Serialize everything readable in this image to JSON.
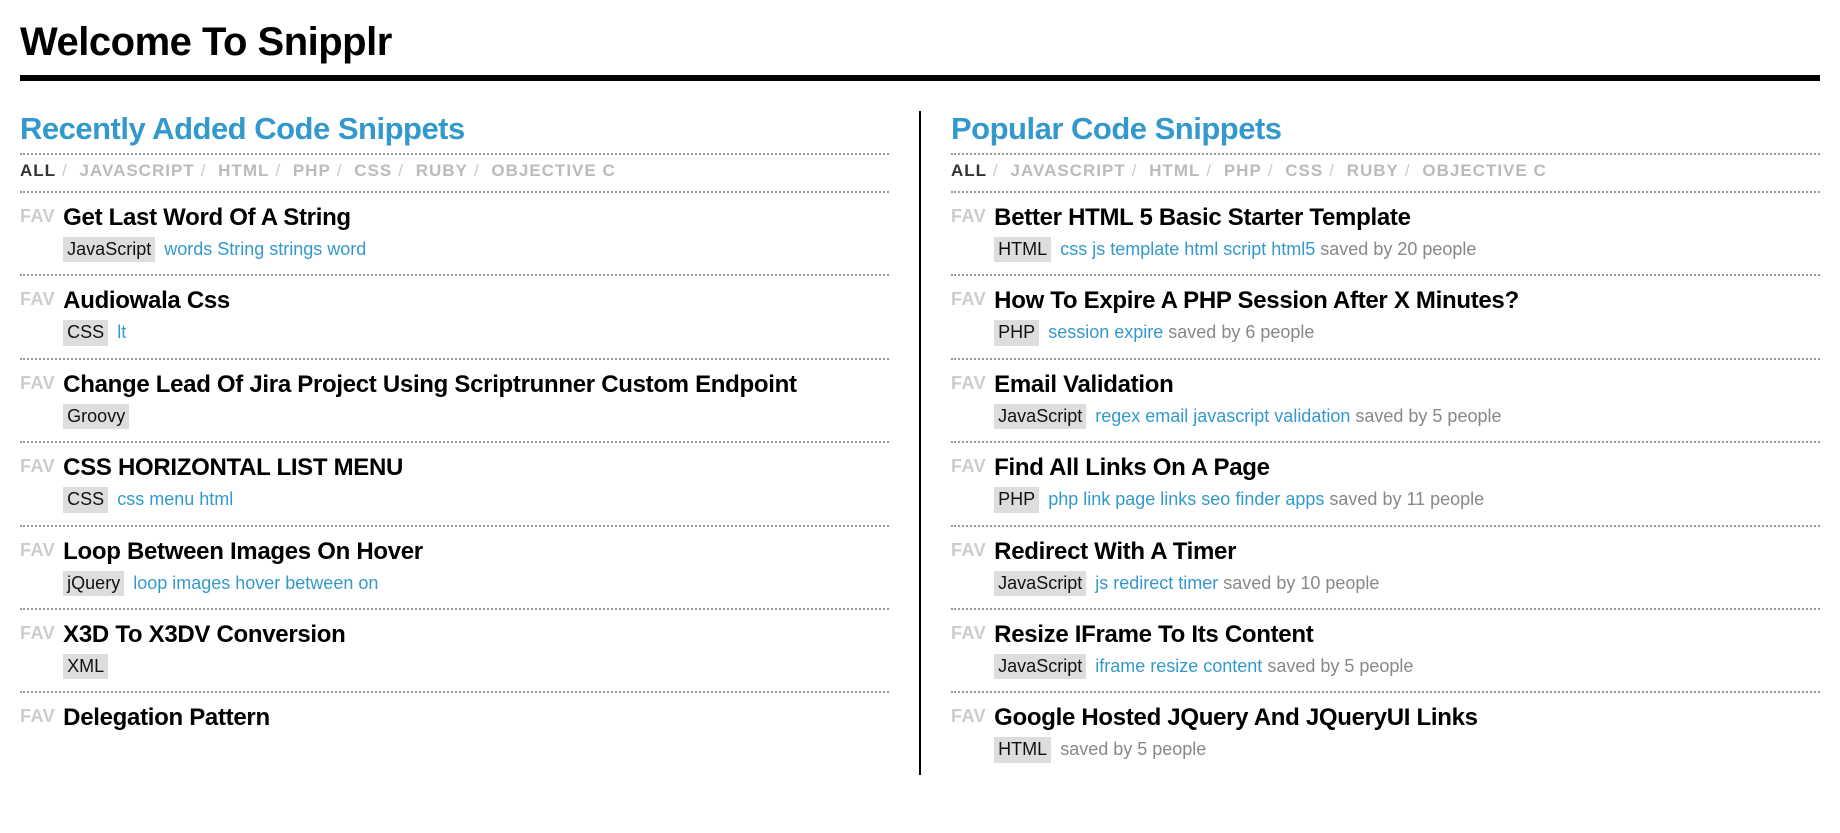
{
  "pageTitle": "Welcome To Snipplr",
  "favLabel": "FAV",
  "filters": [
    {
      "label": "ALL",
      "active": true
    },
    {
      "label": "JAVASCRIPT",
      "active": false
    },
    {
      "label": "HTML",
      "active": false
    },
    {
      "label": "PHP",
      "active": false
    },
    {
      "label": "CSS",
      "active": false
    },
    {
      "label": "RUBY",
      "active": false
    },
    {
      "label": "OBJECTIVE C",
      "active": false
    }
  ],
  "left": {
    "title": "Recently Added Code Snippets",
    "snippets": [
      {
        "title": "Get Last Word Of A String",
        "lang": "JavaScript",
        "tags": "words String strings word",
        "saved": ""
      },
      {
        "title": "Audiowala Css",
        "lang": "CSS",
        "tags": "lt",
        "saved": ""
      },
      {
        "title": "Change Lead Of Jira Project Using Scriptrunner Custom Endpoint",
        "lang": "Groovy",
        "tags": "",
        "saved": ""
      },
      {
        "title": "CSS HORIZONTAL LIST MENU",
        "lang": "CSS",
        "tags": "css menu html",
        "saved": ""
      },
      {
        "title": "Loop Between Images On Hover",
        "lang": "jQuery",
        "tags": "loop images hover between on",
        "saved": ""
      },
      {
        "title": "X3D To X3DV Conversion",
        "lang": "XML",
        "tags": "",
        "saved": ""
      },
      {
        "title": "Delegation Pattern",
        "lang": "",
        "tags": "",
        "saved": ""
      }
    ]
  },
  "right": {
    "title": "Popular Code Snippets",
    "snippets": [
      {
        "title": "Better HTML 5 Basic Starter Template",
        "lang": "HTML",
        "tags": "css js template html script html5",
        "saved": "saved by 20 people"
      },
      {
        "title": "How To Expire A PHP Session After X Minutes?",
        "lang": "PHP",
        "tags": "session expire",
        "saved": "saved by 6 people"
      },
      {
        "title": "Email Validation",
        "lang": "JavaScript",
        "tags": "regex email javascript validation",
        "saved": "saved by 5 people"
      },
      {
        "title": "Find All Links On A Page",
        "lang": "PHP",
        "tags": "php link page links seo finder apps",
        "saved": "saved by 11 people"
      },
      {
        "title": "Redirect With A Timer",
        "lang": "JavaScript",
        "tags": "js redirect timer",
        "saved": "saved by 10 people"
      },
      {
        "title": "Resize IFrame To Its Content",
        "lang": "JavaScript",
        "tags": "iframe resize content",
        "saved": "saved by 5 people"
      },
      {
        "title": "Google Hosted JQuery And JQueryUI Links",
        "lang": "HTML",
        "tags": "",
        "saved": "saved by 5 people"
      }
    ]
  }
}
